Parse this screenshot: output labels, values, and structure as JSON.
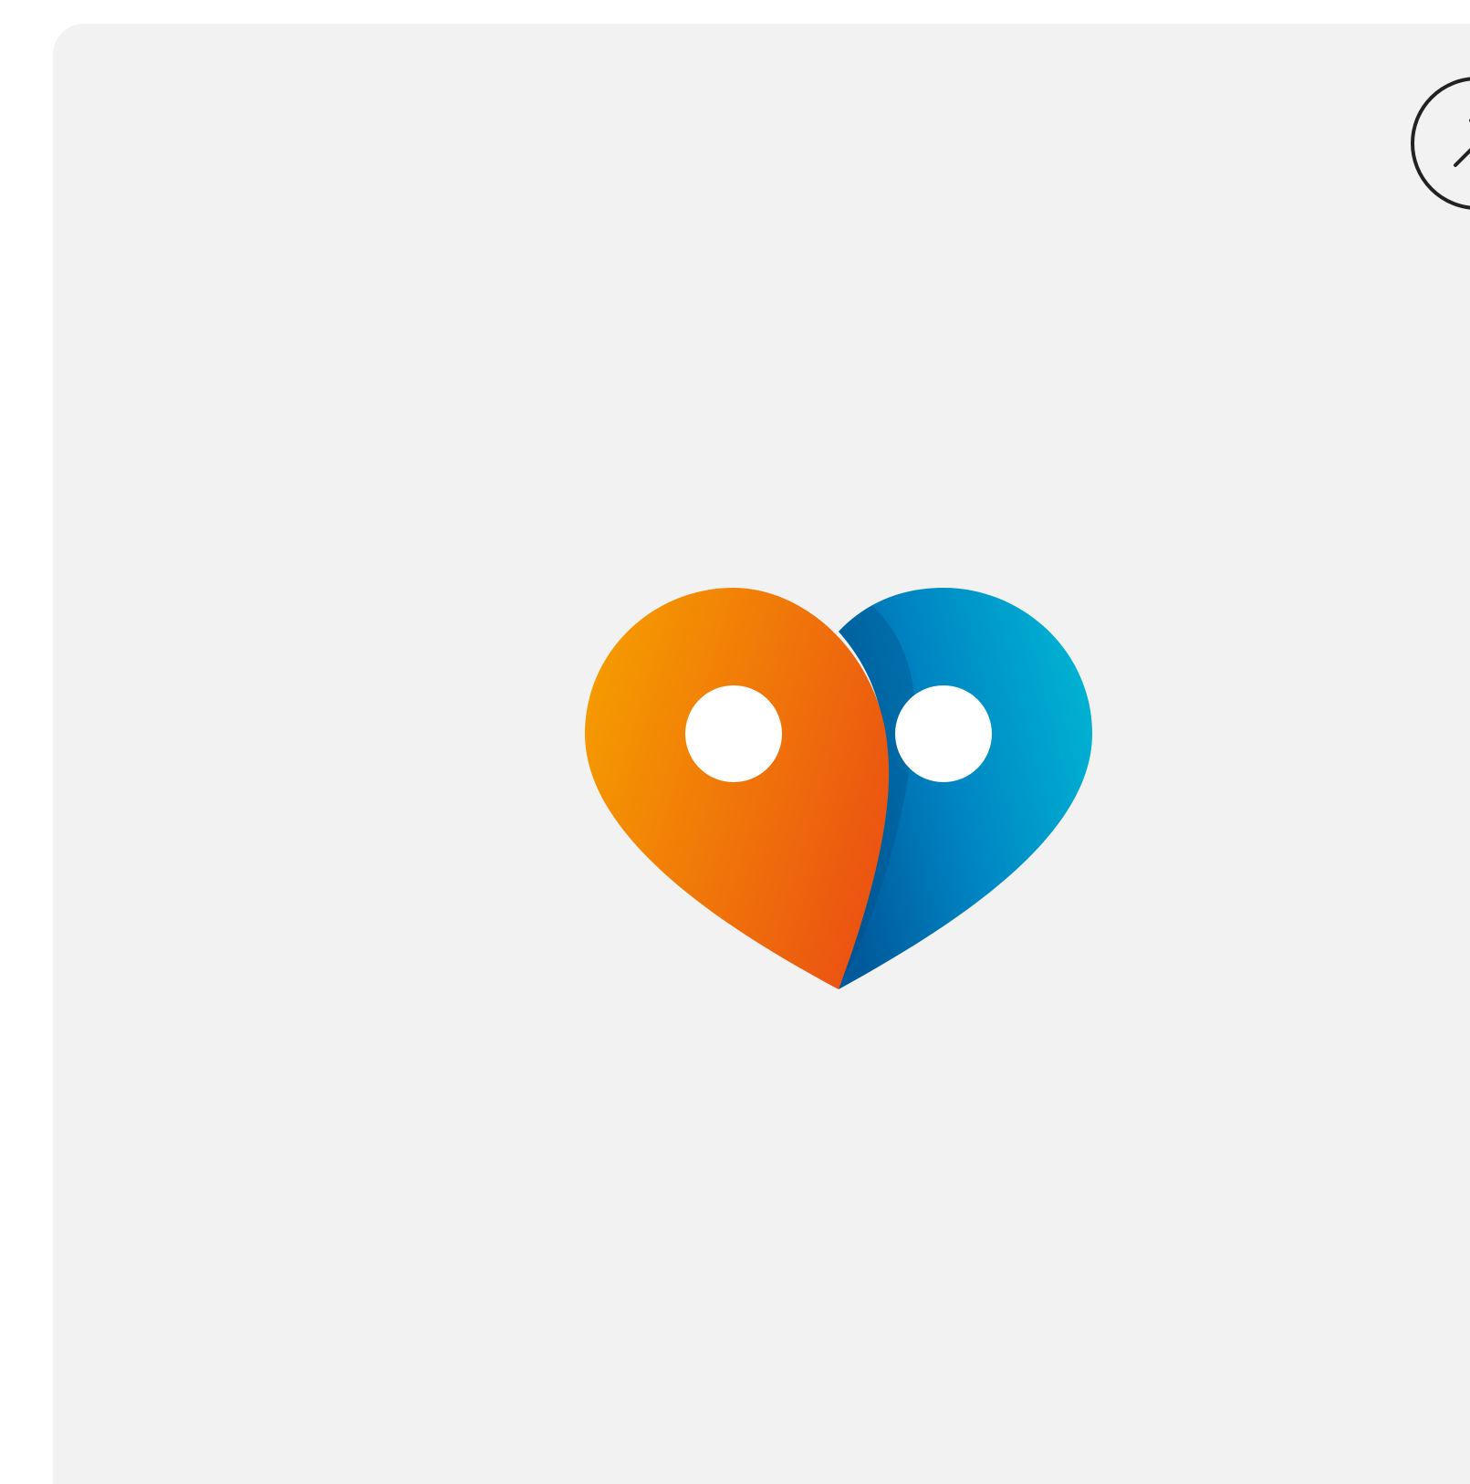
{
  "card": {
    "background": "#f2f2f2"
  },
  "logo": {
    "shape": "heart-of-two-location-pins",
    "left_pin_colors": [
      "#f59a00",
      "#eb5212"
    ],
    "right_pin_colors": [
      "#005a9b",
      "#00b2d3"
    ],
    "hole_color": "#ffffff"
  },
  "open_button": {
    "icon": "arrow-up-right-icon",
    "stroke_color": "#222222"
  }
}
